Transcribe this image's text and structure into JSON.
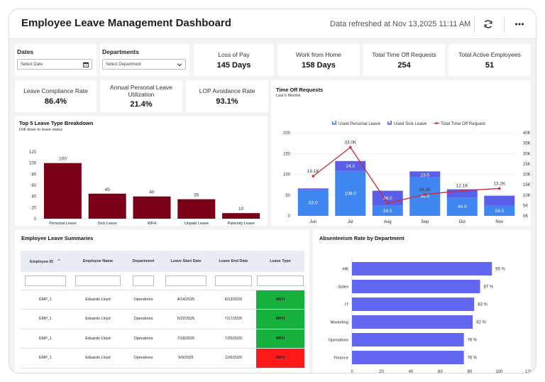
{
  "header": {
    "title": "Employee Leave Management Dashboard",
    "refreshed": "Data refreshed at Nov 13,2025 11:11 AM",
    "refresh_icon": "refresh-icon",
    "more_icon": "more-options-icon"
  },
  "filters": {
    "dates_label": "Dates",
    "dates_placeholder": "Select Date",
    "dates_icon": "calendar-icon",
    "departments_label": "Departments",
    "departments_placeholder": "Select Department",
    "departments_icon": "chevron-down-icon"
  },
  "kpis": [
    {
      "title": "Loss of Pay",
      "value": "145 Days"
    },
    {
      "title": "Work from Home",
      "value": "158 Days"
    },
    {
      "title": "Total Time Off Requests",
      "value": "254"
    },
    {
      "title": "Total Active Employees",
      "value": "51"
    },
    {
      "title": "Leave Compliance Rate",
      "value": "86.4%"
    },
    {
      "title": "Annual Personal Leave Utilization",
      "value": "21.4%"
    },
    {
      "title": "LOP Avoidance Rate",
      "value": "93.1%"
    }
  ],
  "leave_type_panel": {
    "title": "Top 5 Leave Type Breakdown",
    "subtitle": "Drill down to leave status"
  },
  "time_off_panel": {
    "title": "Time Off Requests",
    "subtitle": "Last 6 Months"
  },
  "summaries": {
    "title": "Employee Leave Summaries",
    "columns": [
      "Employee ID",
      "Employee Name",
      "Department",
      "Leave Start Date",
      "Leave End Date",
      "Leave Type"
    ],
    "sort_icon": "sort-ascending-icon",
    "rows": [
      {
        "id": "EMP_1",
        "name": "Eduardo Lloyd",
        "dept": "Operations",
        "start": "4/14/2025",
        "end": "6/13/2025",
        "type": "WFH",
        "type_color": "#16b13c"
      },
      {
        "id": "EMP_1",
        "name": "Eduardo Lloyd",
        "dept": "Operations",
        "start": "5/22/2025",
        "end": "7/17/2025",
        "type": "WFH",
        "type_color": "#16b13c"
      },
      {
        "id": "EMP_1",
        "name": "Eduardo Lloyd",
        "dept": "Operations",
        "start": "7/18/2025",
        "end": "7/25/2025",
        "type": "WFH",
        "type_color": "#16b13c"
      },
      {
        "id": "EMP_1",
        "name": "Eduardo Lloyd",
        "dept": "Operations",
        "start": "9/9/2025",
        "end": "11/6/2025",
        "type": "WFH",
        "type_color": "#ff1a1a"
      }
    ]
  },
  "absenteeism_panel": {
    "title": "Absenteeism Rate by Department"
  },
  "colors": {
    "bar_maroon": "#7a0019",
    "personal_leave": "#3f86f0",
    "sick_leave": "#5a5ee8",
    "total_line": "#c4313f",
    "absenteeism_bar": "#6366f1"
  },
  "chart_data": [
    {
      "type": "bar",
      "categories": [
        "Personal Leave",
        "Sick Leave",
        "WFH",
        "Unpaid Leave",
        "Paternity Leave"
      ],
      "values": [
        100,
        45,
        40,
        35,
        10
      ],
      "ylim": [
        0,
        120
      ],
      "yticks": [
        0,
        20,
        40,
        60,
        80,
        100,
        120
      ],
      "grid": false
    },
    {
      "type": "bar",
      "categories": [
        "Jun",
        "Jul",
        "Aug",
        "Sep",
        "Oct",
        "Nov"
      ],
      "stacked": true,
      "series": [
        {
          "name": "Used Personal Leave",
          "values": [
            63.0,
            108.0,
            24.5,
            94.0,
            44.0,
            24.5
          ]
        },
        {
          "name": "Used Sick Leave",
          "values": [
            3.0,
            24.0,
            36.0,
            13.0,
            20.0,
            24.0
          ],
          "value_labels": [
            "",
            "24.0",
            "36.0",
            "13.0",
            "",
            ""
          ]
        },
        {
          "name": "Total Time Off Request",
          "type": "line",
          "axis": "right",
          "values": [
            19100,
            33000,
            6100,
            10300,
            12100,
            13200
          ],
          "value_labels": [
            "19.1K",
            "33.0K",
            "",
            "18.3K",
            "12.1K",
            "13.2K"
          ]
        }
      ],
      "ylim": [
        0,
        200
      ],
      "yticks": [
        0,
        50,
        100,
        150,
        200
      ],
      "y2lim": [
        0,
        40000
      ],
      "y2ticks": [
        "0K",
        "5K",
        "10K",
        "15K",
        "20K",
        "25K",
        "30K",
        "35K",
        "40K"
      ],
      "legend": "top",
      "grid": true
    },
    {
      "type": "bar",
      "orientation": "horizontal",
      "categories": [
        "HR",
        "Sales",
        "IT",
        "Marketing",
        "Operations",
        "Finance"
      ],
      "values": [
        95,
        87,
        83,
        82,
        76,
        76
      ],
      "value_suffix": " %",
      "xlim": [
        0,
        120
      ],
      "xticks": [
        0,
        20,
        40,
        60,
        80,
        100,
        120
      ],
      "grid": false
    }
  ]
}
